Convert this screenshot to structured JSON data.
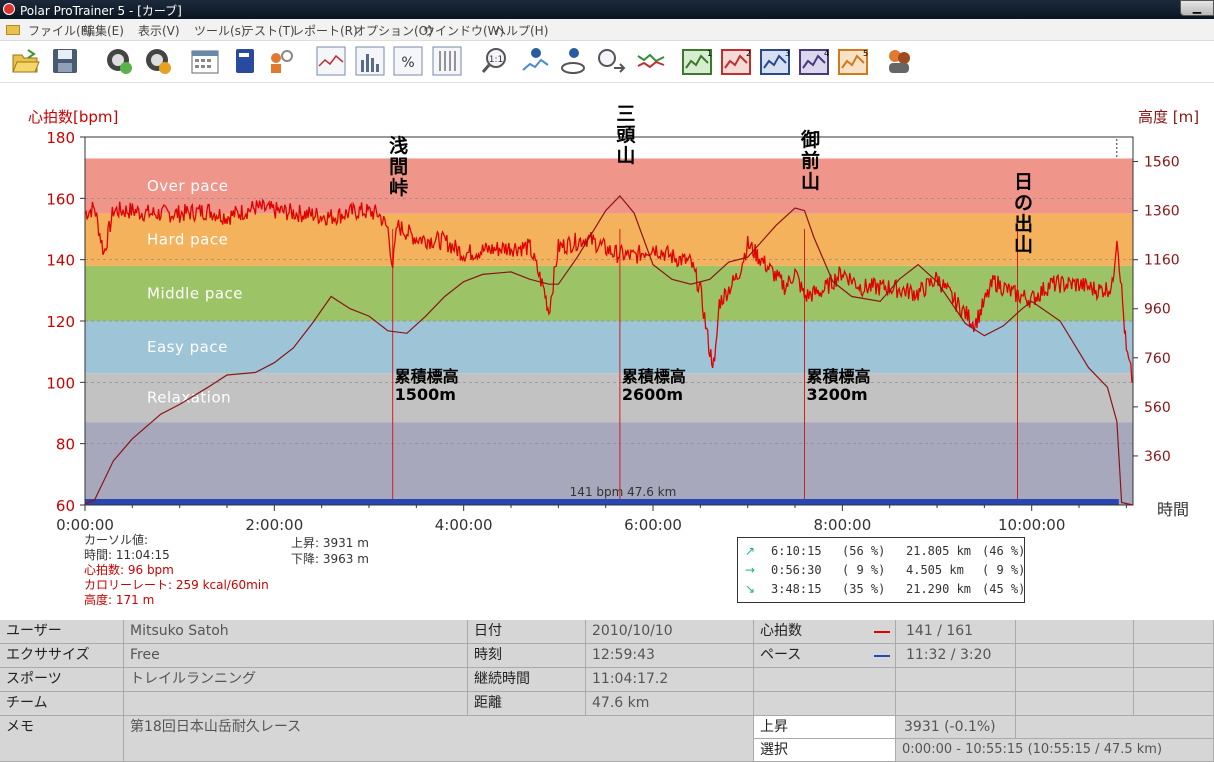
{
  "window": {
    "title": "Polar ProTrainer 5 - [カーブ]",
    "minimize_label": "▁"
  },
  "menu": [
    "ファイル(F)",
    "編集(E)",
    "表示(V)",
    "ツール(s)",
    "テスト(T)",
    "レポート(R)",
    "オプション(O)",
    "ウインドウ(W)",
    "ヘルプ(H)"
  ],
  "toolbar": [
    "open-folder",
    "save-disk",
    "sync-refresh",
    "settings-gear",
    "calendar",
    "book",
    "user-search",
    "line-chart",
    "bar-chart",
    "percent",
    "table-grid",
    "zoom-1-1",
    "info-chart",
    "info-satellite",
    "clock-arrows",
    "multi-line",
    "curve-1",
    "curve-2",
    "curve-3",
    "curve-4",
    "curve-5",
    "users"
  ],
  "colors": {
    "hr_line": "#e00000",
    "altitude_line": "#8a1515",
    "over_pace": "#f0958a",
    "hard_pace": "#f4b25c",
    "middle_pace": "#9cc467",
    "easy_pace": "#9ec4d8",
    "relaxation": "#c2c2c2",
    "rest": "#a8a8bc",
    "pace_bar": "#2846b4"
  },
  "chart_data": {
    "type": "line",
    "y_left_label": "心拍数[bpm]",
    "y_right_label": "高度 [m]",
    "x_label": "時間",
    "x_ticks": [
      "0:00:00",
      "2:00:00",
      "4:00:00",
      "6:00:00",
      "8:00:00",
      "10:00:00"
    ],
    "y_left_ticks": [
      60,
      80,
      100,
      120,
      140,
      160,
      180
    ],
    "y_right_ticks": [
      360,
      560,
      760,
      960,
      1160,
      1360,
      1560
    ],
    "xlim_hours": [
      0,
      11.07
    ],
    "ylim_left": [
      60,
      180
    ],
    "ylim_right": [
      160,
      1660
    ],
    "zones": [
      {
        "name": "Over pace",
        "lo": 155,
        "hi": 173
      },
      {
        "name": "Hard pace",
        "lo": 138,
        "hi": 155
      },
      {
        "name": "Middle pace",
        "lo": 120,
        "hi": 138
      },
      {
        "name": "Easy pace",
        "lo": 103,
        "hi": 120
      },
      {
        "name": "Relaxation",
        "lo": 87,
        "hi": 103
      },
      {
        "name": "",
        "lo": 60,
        "hi": 87
      }
    ],
    "series": [
      {
        "name": "心拍数",
        "axis": "left",
        "x": [
          0,
          0.1,
          0.2,
          0.3,
          0.5,
          0.7,
          1.0,
          1.3,
          1.5,
          1.8,
          2.0,
          2.3,
          2.6,
          2.9,
          3.1,
          3.2,
          3.25,
          3.3,
          3.5,
          3.8,
          4.0,
          4.2,
          4.5,
          4.7,
          4.85,
          4.9,
          5.0,
          5.3,
          5.6,
          5.8,
          6.0,
          6.2,
          6.4,
          6.5,
          6.6,
          6.65,
          6.7,
          6.9,
          7.0,
          7.2,
          7.4,
          7.5,
          7.6,
          7.8,
          8.0,
          8.2,
          8.5,
          8.8,
          9.0,
          9.2,
          9.4,
          9.6,
          9.8,
          10.0,
          10.2,
          10.5,
          10.7,
          10.85,
          10.9,
          10.95,
          11.0,
          11.07
        ],
        "y": [
          155,
          157,
          142,
          156,
          156,
          155,
          155,
          156,
          154,
          157,
          156,
          155,
          154,
          156,
          155,
          150,
          138,
          151,
          147,
          146,
          142,
          143,
          144,
          144,
          130,
          123,
          144,
          147,
          142,
          141,
          144,
          141,
          139,
          130,
          110,
          105,
          126,
          135,
          145,
          138,
          131,
          136,
          128,
          130,
          136,
          131,
          131,
          129,
          134,
          126,
          119,
          133,
          129,
          127,
          132,
          132,
          130,
          131,
          148,
          130,
          110,
          100
        ]
      },
      {
        "name": "高度",
        "axis": "right",
        "x": [
          0,
          0.1,
          0.3,
          0.5,
          0.8,
          1.0,
          1.3,
          1.5,
          1.8,
          2.0,
          2.2,
          2.4,
          2.6,
          2.8,
          3.0,
          3.2,
          3.4,
          3.6,
          3.8,
          4.0,
          4.2,
          4.5,
          4.7,
          4.9,
          5.0,
          5.2,
          5.5,
          5.65,
          5.8,
          6.0,
          6.2,
          6.4,
          6.6,
          6.8,
          7.0,
          7.3,
          7.5,
          7.6,
          7.7,
          7.9,
          8.1,
          8.4,
          8.6,
          8.8,
          9.0,
          9.3,
          9.5,
          9.7,
          9.9,
          10.0,
          10.3,
          10.6,
          10.8,
          10.9,
          10.95,
          11.07
        ],
        "y": [
          165,
          180,
          340,
          430,
          530,
          570,
          640,
          690,
          700,
          740,
          800,
          900,
          1010,
          960,
          930,
          870,
          860,
          930,
          1010,
          1070,
          1100,
          1110,
          1080,
          1060,
          1060,
          1170,
          1360,
          1420,
          1350,
          1140,
          1080,
          1060,
          1080,
          1150,
          1170,
          1300,
          1370,
          1360,
          1250,
          1070,
          1010,
          990,
          1080,
          1140,
          1070,
          900,
          850,
          890,
          960,
          990,
          910,
          720,
          640,
          500,
          170,
          160
        ]
      }
    ],
    "markers": [
      {
        "x": 3.25,
        "peak": "浅\n間\n峠",
        "cum_label": "累積標高",
        "cum_value": "1500m"
      },
      {
        "x": 5.65,
        "peak": "三\n頭\n山",
        "cum_label": "累積標高",
        "cum_value": "2600m"
      },
      {
        "x": 7.6,
        "peak": "御\n前\n山",
        "cum_label": "累積標高",
        "cum_value": "3200m"
      },
      {
        "x": 9.85,
        "peak": "日\nの\n出\n山",
        "cum_label": "",
        "cum_value": ""
      }
    ],
    "selection_end_hours": 10.92,
    "pace_bar_label": "141 bpm 47.6 km"
  },
  "cursor": {
    "title": "カーソル値:",
    "time": "時間: 11:04:15",
    "hr": "心拍数: 96 bpm",
    "calorie": "カロリーレート: 259 kcal/60min",
    "altitude": "高度: 171 m"
  },
  "ascent": {
    "up": "上昇: 3931 m",
    "down": "下降: 3963 m"
  },
  "summary": [
    {
      "arrow": "↗",
      "time": "6:10:15",
      "pct": "(56 %)",
      "km": "21.805 km",
      "kpct": "(46 %)"
    },
    {
      "arrow": "→",
      "time": "0:56:30",
      "pct": "( 9 %)",
      "km": "4.505 km",
      "kpct": "( 9 %)"
    },
    {
      "arrow": "↘",
      "time": "3:48:15",
      "pct": "(35 %)",
      "km": "21.290 km",
      "kpct": "(45 %)"
    }
  ],
  "table": {
    "user_label": "ユーザー",
    "user_value": "Mitsuko Satoh",
    "exercise_label": "エクササイズ",
    "exercise_value": "Free",
    "sport_label": "スポーツ",
    "sport_value": "トレイルランニング",
    "team_label": "チーム",
    "team_value": "",
    "memo_label": "メモ",
    "memo_value": "第18回日本山岳耐久レース",
    "date_label": "日付",
    "date_value": "2010/10/10",
    "time_label": "時刻",
    "time_value": "12:59:43",
    "duration_label": "継続時間",
    "duration_value": "11:04:17.2",
    "distance_label": "距離",
    "distance_value": "47.6 km",
    "hr_label": "心拍数",
    "hr_value": "141 / 161",
    "pace_label": "ペース",
    "pace_value": "11:32 / 3:20",
    "ascent_label": "上昇",
    "ascent_value": "3931 (-0.1%)",
    "select_label": "選択",
    "select_value": "0:00:00 - 10:55:15 (10:55:15 / 47.5 km)"
  }
}
